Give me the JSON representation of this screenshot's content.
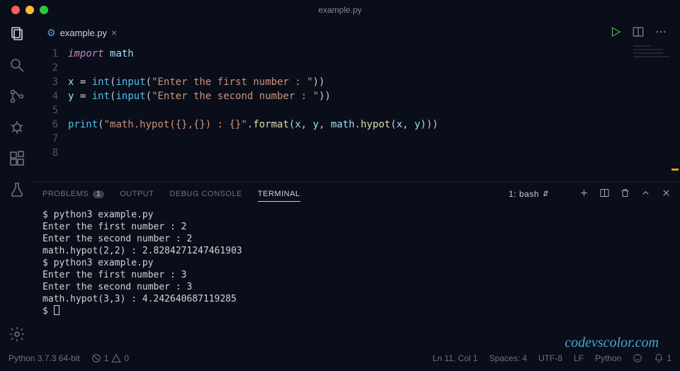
{
  "window": {
    "title": "example.py"
  },
  "tab": {
    "filename": "example.py"
  },
  "code": {
    "lines": [
      {
        "n": "1",
        "html": "<span class='kw'>import</span> <span class='var'>math</span>"
      },
      {
        "n": "2",
        "html": ""
      },
      {
        "n": "3",
        "html": "<span class='var'>x</span> <span class='op'>=</span> <span class='bi'>int</span>(<span class='bi'>input</span>(<span class='str'>\"Enter the first number : \"</span>))"
      },
      {
        "n": "4",
        "html": "<span class='var'>y</span> <span class='op'>=</span> <span class='bi'>int</span>(<span class='bi'>input</span>(<span class='str'>\"Enter the second number : \"</span>))"
      },
      {
        "n": "5",
        "html": ""
      },
      {
        "n": "6",
        "html": "<span class='bi'>print</span>(<span class='str'>\"math.hypot({},{}) : {}\"</span>.<span class='fn'>format</span>(<span class='var'>x</span>, <span class='var'>y</span>, <span class='var'>math</span>.<span class='fn'>hypot</span>(<span class='var'>x</span>, <span class='var'>y</span>)))"
      },
      {
        "n": "7",
        "html": ""
      },
      {
        "n": "8",
        "html": ""
      }
    ]
  },
  "panel": {
    "tabs": {
      "problems": "PROBLEMS",
      "problems_count": "1",
      "output": "OUTPUT",
      "debug": "DEBUG CONSOLE",
      "terminal": "TERMINAL"
    },
    "term_selector": "1: bash"
  },
  "terminal": {
    "lines": [
      "$ python3 example.py",
      "Enter the first number : 2",
      "Enter the second number : 2",
      "math.hypot(2,2) : 2.8284271247461903",
      "$ python3 example.py",
      "Enter the first number : 3",
      "Enter the second number : 3",
      "math.hypot(3,3) : 4.242640687119285"
    ],
    "prompt": "$ "
  },
  "status": {
    "interpreter": "Python 3.7.3 64-bit",
    "errors": "1",
    "warnings": "0",
    "cursor": "Ln 11, Col 1",
    "spaces": "Spaces: 4",
    "encoding": "UTF-8",
    "eol": "LF",
    "lang": "Python",
    "bell": "1"
  },
  "watermark": "codevscolor.com"
}
